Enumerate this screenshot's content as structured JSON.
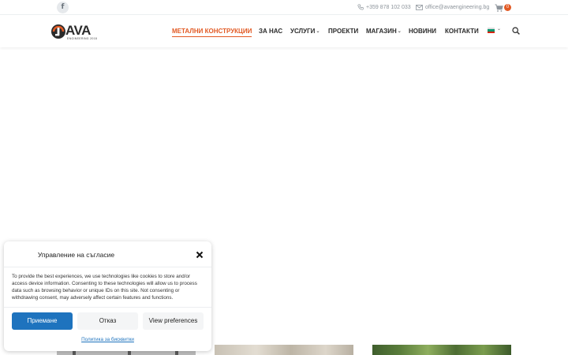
{
  "topbar": {
    "social_icon": "facebook-icon",
    "social_glyph": "f",
    "phone": "+359 878 102 033",
    "email": "office@avaengineering.bg",
    "cart_count": "0"
  },
  "header": {
    "logo_word": "AVA",
    "logo_sub": "ENGINEERING 2018",
    "nav": [
      {
        "label": "МЕТАЛНИ КОНСТРУКЦИИ",
        "active": true
      },
      {
        "label": "ЗА НАС"
      },
      {
        "label": "УСЛУГИ",
        "has_dropdown": true
      },
      {
        "label": "ПРОЕКТИ"
      },
      {
        "label": "МАГАЗИН",
        "has_dropdown": true
      },
      {
        "label": "НОВИНИ"
      },
      {
        "label": "КОНТАКТИ"
      }
    ],
    "language_icon": "bulgarian-flag-icon",
    "search_icon": "search-icon"
  },
  "consent": {
    "title": "Управление на съгласие",
    "text": "To provide the best experiences, we use technologies like cookies to store and/or access device information. Consenting to these technologies will allow us to process data such as browsing behavior or unique IDs on this site. Not consenting or withdrawing consent, may adversely affect certain features and functions.",
    "accept_label": "Приемане",
    "deny_label": "Отказ",
    "preferences_label": "View preferences",
    "policy_link": "Политика за бисквитки"
  },
  "colors": {
    "accent": "#e25a24",
    "button_blue": "#1e73be",
    "text_dark": "#2b2b2b"
  }
}
